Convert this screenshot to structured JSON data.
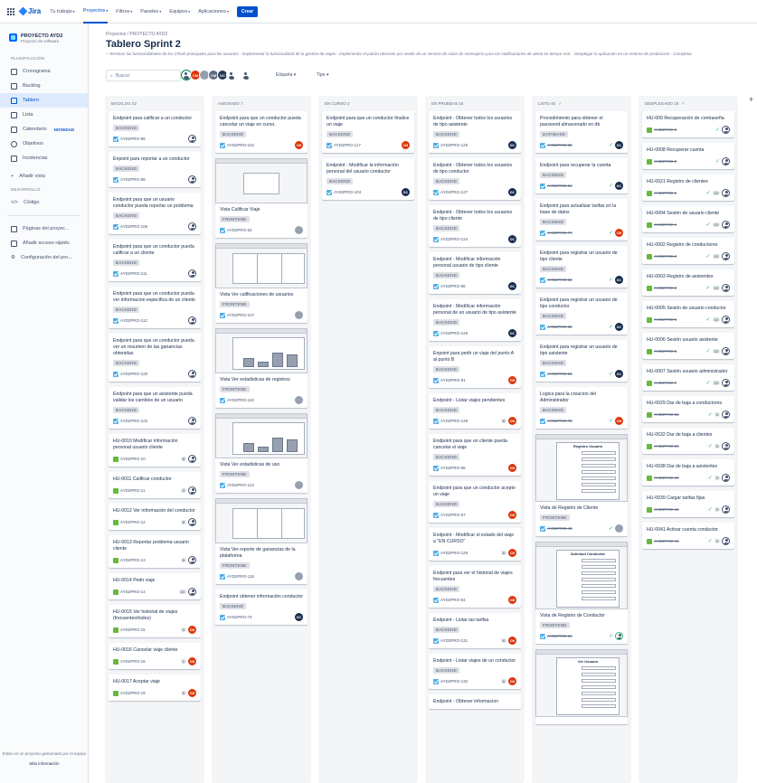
{
  "topbar": {
    "product": "Jira",
    "nav": [
      "Tu trabajo",
      "Proyectos",
      "Filtros",
      "Paneles",
      "Equipos",
      "Aplicaciones"
    ],
    "create": "Crear"
  },
  "sidebar": {
    "project_name": "PROYECTO AYD2",
    "project_type": "Proyecto de software",
    "planning_header": "PLANIFICACIÓN",
    "planning_items": [
      "Cronograma",
      "Backlog",
      "Tablero",
      "Lista",
      "Calendario",
      "Objetivos",
      "Incidencias"
    ],
    "new_badge": "NOVEDAD",
    "add_view": "Añadir vista",
    "dev_header": "DESARROLLO",
    "dev_items": [
      "Código"
    ],
    "bottom_items": [
      "Páginas del proyec...",
      "Añadir acceso rápido",
      "Configuración del pro..."
    ],
    "footer_text": "Estás en un proyecto gestionado por el equipo",
    "footer_link": "Más información"
  },
  "board": {
    "breadcrumb_1": "Proyectos",
    "breadcrumb_sep": "/",
    "breadcrumb_2": "PROYECTO AYD2",
    "title": "Tablero Sprint 2",
    "goal": "~ Terminar las funcionalidades de los CRUD principales para los usuarios - Implementar la funcionalidad de la gestión de viajes - Implementar el patrón observer por medio de un servicio de colas de mensajería para las notificaciones de alerta en tiempo real. - Desplegar la aplicación en un entorno de producción - Completar",
    "search_placeholder": "Buscar",
    "filter_label": "Etiqueta",
    "filter_type": "Tipo",
    "avatars": [
      "",
      "CM",
      "",
      "CM",
      "DC",
      ""
    ],
    "add_column": "+"
  },
  "colors": {
    "accent": "#0052cc",
    "cm": "#de350b",
    "dc": "#172b4d",
    "green": "#36b37e"
  },
  "columns": [
    {
      "header": "BACKLOG 42",
      "cards": [
        {
          "title": "Endpoint para calificar a un conductor",
          "label": "BACKEND",
          "key": "AYD2PRO-88",
          "type": "task",
          "assignee": "person"
        },
        {
          "title": "Enpoint para reportar a un conductor",
          "label": "BACKEND",
          "key": "AYD2PRO-89",
          "type": "task",
          "assignee": "person"
        },
        {
          "title": "Endpoint para que un usuario conductor pueda reportar un problema",
          "label": "BACKEND",
          "key": "AYD2PRO-106",
          "type": "task",
          "assignee": "person"
        },
        {
          "title": "Endpoint para que un conductor pueda calificar a un cliente",
          "label": "BACKEND",
          "key": "AYD2PRO-111",
          "type": "task",
          "assignee": "person"
        },
        {
          "title": "Endpoint para que un conductor pueda ver informacion especifica de un cliente",
          "label": "BACKEND",
          "key": "AYD2PRO-112",
          "type": "task",
          "assignee": "person"
        },
        {
          "title": "Endpoint para que un conductor pueda ver un resumen de las ganancias obtenidas",
          "label": "BACKEND",
          "key": "AYD2PRO-120",
          "type": "task",
          "assignee": "person"
        },
        {
          "title": "Endpoint para que un asistente pueda validar los cambios de un usuario",
          "label": "BACKEND",
          "key": "AYD2PRO-122",
          "type": "task",
          "assignee": "person"
        },
        {
          "title": "HU-0010 Modificar información personal usuario cliente",
          "label": "",
          "key": "AYD2PRO-10",
          "type": "story",
          "points": "8",
          "assignee": "person"
        },
        {
          "title": "HU-0011 Calificar conductor",
          "label": "",
          "key": "AYD2PRO-11",
          "type": "story",
          "points": "3",
          "assignee": "person"
        },
        {
          "title": "HU-0012 Ver información del conductor",
          "label": "",
          "key": "AYD2PRO-12",
          "type": "story",
          "points": "8",
          "assignee": "person"
        },
        {
          "title": "HU-0013 Reportar problema usuario cliente",
          "label": "",
          "key": "AYD2PRO-13",
          "type": "story",
          "points": "5",
          "assignee": "person"
        },
        {
          "title": "HU-0014 Pedir viaje",
          "label": "",
          "key": "AYD2PRO-14",
          "type": "story",
          "points": "10",
          "assignee": "person"
        },
        {
          "title": "HU-0015 Ver historial de viajes (frecuentes/todos)",
          "label": "",
          "key": "AYD2PRO-15",
          "type": "story",
          "points": "3",
          "assignee": "CM"
        },
        {
          "title": "HU-0016 Cancelar viaje cliente",
          "label": "",
          "key": "AYD2PRO-16",
          "type": "story",
          "points": "1",
          "assignee": "CM"
        },
        {
          "title": "HU-0017 Aceptar viaje",
          "label": "",
          "key": "AYD2PRO-19",
          "type": "story",
          "points": "5",
          "assignee": "CM"
        }
      ]
    },
    {
      "header": "ASIGNADO 7",
      "cards": [
        {
          "title": "Endpoint para que un conductor pueda cancelar un viaje en curso.",
          "label": "BACKEND",
          "key": "AYD2PRO-101",
          "type": "task",
          "assignee": "CM"
        },
        {
          "title": "Vista Calificar Viaje",
          "label": "FRONTEND",
          "key": "AYD2PRO-62",
          "type": "task",
          "assignee": "photo",
          "thumb": "form"
        },
        {
          "title": "Vista Ver calificaciones de usuarios",
          "label": "FRONTEND",
          "key": "AYD2PRO-107",
          "type": "task",
          "assignee": "photo",
          "thumb": "table"
        },
        {
          "title": "Vista Ver estadisticas de registros",
          "label": "FRONTEND",
          "key": "AYD2PRO-110",
          "type": "task",
          "assignee": "photo",
          "thumb": "chart"
        },
        {
          "title": "Vista Ver estadisticas de uso",
          "label": "FRONTEND",
          "key": "AYD2PRO-113",
          "type": "task",
          "assignee": "photo",
          "thumb": "chart"
        },
        {
          "title": "Vista Ver reporte de ganancias de la plataforma",
          "label": "FRONTEND",
          "key": "AYD2PRO-115",
          "type": "task",
          "assignee": "photo",
          "thumb": "table"
        },
        {
          "title": "Endpoint obtener información conductor",
          "label": "BACKEND",
          "key": "AYD2PRO-74",
          "type": "task",
          "assignee": "DC"
        }
      ]
    },
    {
      "header": "EN CURSO 2",
      "cards": [
        {
          "title": "Endpoint para que un conductor finalice un viaje",
          "label": "BACKEND",
          "key": "AYD2PRO-117",
          "type": "task",
          "assignee": "CM"
        },
        {
          "title": "Endpoint - Modificar la información personal del usuario conductor",
          "label": "BACKEND",
          "key": "AYD2PRO-104",
          "type": "task",
          "assignee": "DC"
        }
      ]
    },
    {
      "header": "EN PRUEBAS 16",
      "cards": [
        {
          "title": "Endpoint - Obtener todos los usuarios de tipo asistente",
          "label": "BACKEND",
          "key": "AYD2PRO-125",
          "type": "task",
          "assignee": "DC"
        },
        {
          "title": "Endpoint - Obtener todos los usuarios de tipo conductor",
          "label": "BACKEND",
          "key": "AYD2PRO-127",
          "type": "task",
          "assignee": "DC"
        },
        {
          "title": "Endpoint - Obtener todos los usuarios de tipo cliente",
          "label": "BACKEND",
          "key": "AYD2PRO-124",
          "type": "task",
          "assignee": "DC"
        },
        {
          "title": "Endpoint - Modificar información personal usuario de tipo cliente",
          "label": "BACKEND",
          "key": "AYD2PRO-86",
          "type": "task",
          "assignee": "DC"
        },
        {
          "title": "Endpoint - Modificar información personal de un usuario de tipo asistente",
          "label": "BACKEND",
          "key": "AYD2PRO-126",
          "type": "task",
          "assignee": "DC"
        },
        {
          "title": "Enpoint para pedir un viaje del punto A al punto B",
          "label": "BACKEND",
          "key": "AYD2PRO-81",
          "type": "task",
          "assignee": "CM"
        },
        {
          "title": "Endpoint - Listar viajes pendientes",
          "label": "BACKEND",
          "key": "AYD2PRO-128",
          "type": "task",
          "points": "8",
          "assignee": "CM"
        },
        {
          "title": "Endpoint para que un cliente pueda cancelar el viaje",
          "label": "BACKEND",
          "key": "AYD2PRO-96",
          "type": "task",
          "assignee": "CM"
        },
        {
          "title": "Endpoint para que un conductor acepte un viaje",
          "label": "BACKEND",
          "key": "AYD2PRO-97",
          "type": "task",
          "assignee": "CM"
        },
        {
          "title": "Endpoint - Modificar el estado del viaje a \"EN CURSO\"",
          "label": "",
          "key": "AYD2PRO-129",
          "type": "task",
          "points": "8",
          "assignee": "CM"
        },
        {
          "title": "Endpoint para ver el historial de viajes frecuentes",
          "label": "BACKEND",
          "key": "AYD2PRO-94",
          "type": "task",
          "assignee": "CM"
        },
        {
          "title": "Endpoint - Listar las tarifas",
          "label": "BACKEND",
          "key": "AYD2PRO-131",
          "type": "task",
          "points": "8",
          "assignee": "CM"
        },
        {
          "title": "Endpoint - Listar viajes de un conductor",
          "label": "BACKEND",
          "key": "AYD2PRO-132",
          "type": "task",
          "points": "8",
          "assignee": "CM"
        },
        {
          "title": "Endpoint - Obtener informacion",
          "label": "",
          "key": "",
          "type": "task",
          "assignee": ""
        }
      ]
    },
    {
      "header": "LISTO 40",
      "cards": [
        {
          "title": "Procedimiento para obtener el password almacenado en db",
          "label": "DATABASE",
          "key": "AYD2PRO-86",
          "type": "task",
          "done": true,
          "assignee": "DC"
        },
        {
          "title": "Endpoint para recuperar la cuenta",
          "label": "BACKEND",
          "key": "AYD2PRO-84",
          "type": "task",
          "done": true,
          "assignee": "DC"
        },
        {
          "title": "Endpoint para actualizar tarifas en la base de datos",
          "label": "BACKEND",
          "key": "AYD2PRO-77",
          "type": "task",
          "done": true,
          "assignee": "CM"
        },
        {
          "title": "Endpoint para registrar un usuario de tipo cliente",
          "label": "BACKEND",
          "key": "AYD2PRO-51",
          "type": "task",
          "done": true,
          "assignee": "DC"
        },
        {
          "title": "Endpoint para registrar un usuario de tipo conductor",
          "label": "BACKEND",
          "key": "AYD2PRO-52",
          "type": "task",
          "done": true,
          "assignee": "DC"
        },
        {
          "title": "Endpoint para registrar un usuario de tipo asistente",
          "label": "BACKEND",
          "key": "AYD2PRO-53",
          "type": "task",
          "done": true,
          "assignee": "DC"
        },
        {
          "title": "Logica para la creacion del Administrador",
          "label": "BACKEND",
          "key": "AYD2PRO-76",
          "type": "task",
          "done": true,
          "assignee": "CM"
        },
        {
          "title": "Vista de Registro de Cliente",
          "label": "FRONTEND",
          "key": "AYD2PRO-49",
          "type": "task",
          "done": true,
          "assignee": "photo",
          "thumb": "regform",
          "thumb_title": "Registro Usuario"
        },
        {
          "title": "Vista de Registro de Conductor",
          "label": "FRONTEND",
          "key": "AYD2PRO-50",
          "type": "task",
          "done": true,
          "assignee": "person-green",
          "thumb": "regform",
          "thumb_title": "Solicitud Conductor"
        },
        {
          "title": "",
          "label": "",
          "key": "",
          "type": "task",
          "assignee": "",
          "thumb": "regform",
          "thumb_title": "Ver Usuario"
        }
      ]
    },
    {
      "header": "DESPLEGADO 19",
      "cards": [
        {
          "title": "HU-009 Recuperación de contraseña",
          "label": "",
          "key": "AYD2PRO-9",
          "type": "story",
          "done": true,
          "assignee": "person"
        },
        {
          "title": "HU-0008 Recuperar cuenta",
          "label": "",
          "key": "AYD2PRO-8",
          "type": "story",
          "done": true,
          "assignee": "person"
        },
        {
          "title": "HU-0021 Registro de clientes",
          "label": "",
          "key": "AYD2PRO-1",
          "type": "story",
          "done": true,
          "points": "10",
          "assignee": "person"
        },
        {
          "title": "HU-0004 Sesión de usuario cliente",
          "label": "",
          "key": "AYD2PRO-4",
          "type": "story",
          "done": true,
          "points": "10",
          "assignee": "person"
        },
        {
          "title": "HU-0002 Registro de conductores",
          "label": "",
          "key": "AYD2PRO-2",
          "type": "story",
          "done": true,
          "points": "10",
          "assignee": "person"
        },
        {
          "title": "HU-0003 Registro de asistentes",
          "label": "",
          "key": "AYD2PRO-3",
          "type": "story",
          "done": true,
          "points": "10",
          "assignee": "person"
        },
        {
          "title": "HU-0005 Sesión de usuario conductor",
          "label": "",
          "key": "AYD2PRO-5",
          "type": "story",
          "done": true,
          "points": "10",
          "assignee": "person"
        },
        {
          "title": "HU-0006 Sesión usuario asistente",
          "label": "",
          "key": "AYD2PRO-6",
          "type": "story",
          "done": true,
          "points": "10",
          "assignee": "person"
        },
        {
          "title": "HU-0007 Sesión usuario administrador",
          "label": "",
          "key": "AYD2PRO-7",
          "type": "story",
          "done": true,
          "points": "10",
          "assignee": "person"
        },
        {
          "title": "HU-0029 Dar de baja a conductores",
          "label": "",
          "key": "AYD2PRO-31",
          "type": "story",
          "done": true,
          "points": "3",
          "assignee": "person"
        },
        {
          "title": "HU-0032 Dar de baja a clientes",
          "label": "",
          "key": "AYD2PRO-34",
          "type": "story",
          "done": true,
          "points": "3",
          "assignee": "person"
        },
        {
          "title": "HU-0038 Dar de baja a asistentes",
          "label": "",
          "key": "AYD2PRO-40",
          "type": "story",
          "done": true,
          "points": "3",
          "assignee": "person"
        },
        {
          "title": "HU-0039 Cargar tarifas fijas",
          "label": "",
          "key": "AYD2PRO-41",
          "type": "story",
          "done": true,
          "points": "5",
          "assignee": "person"
        },
        {
          "title": "HU-0041 Activar cuenta conductor",
          "label": "",
          "key": "AYD2PRO-44",
          "type": "story",
          "done": true,
          "points": "3",
          "assignee": "person"
        }
      ]
    }
  ]
}
